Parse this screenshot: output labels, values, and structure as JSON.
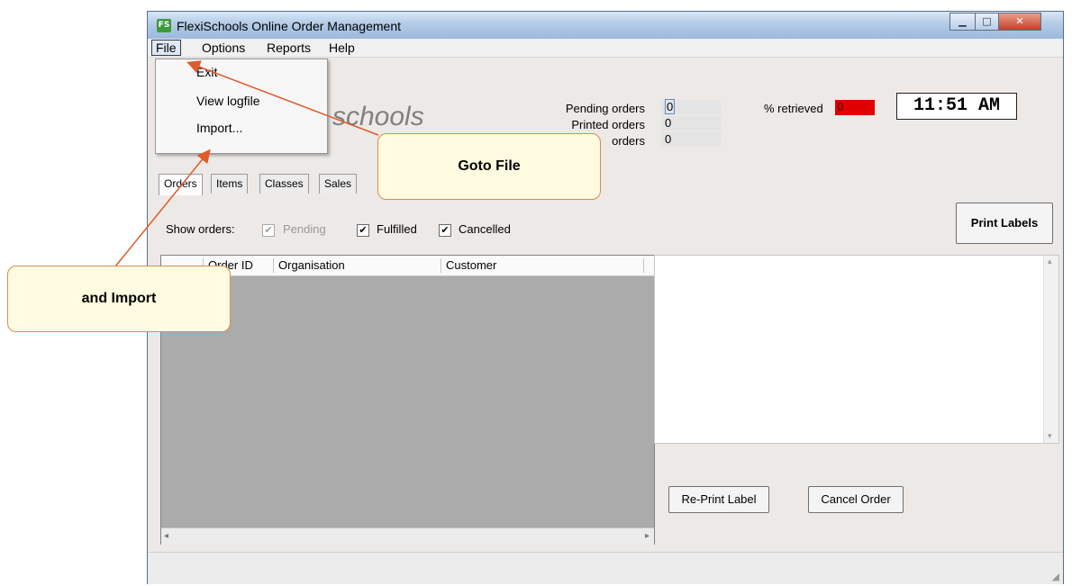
{
  "window": {
    "title": "FlexiSchools Online Order Management",
    "app_icon_text": "FS",
    "min_glyph": "▁",
    "max_glyph": "□",
    "close_glyph": "✕"
  },
  "menu": {
    "file": "File",
    "options": "Options",
    "reports": "Reports",
    "help": "Help"
  },
  "file_menu": {
    "items": [
      "Exit",
      "View logfile",
      "Import..."
    ]
  },
  "logo": "schools",
  "stats": {
    "pending_label": "Pending orders",
    "pending_value": "0",
    "printed_label": "Printed orders",
    "printed_value": "0",
    "other_label": "orders",
    "other_value": "0"
  },
  "retrieved": {
    "label": "% retrieved",
    "value": "0",
    "bar_color": "#e00000"
  },
  "clock": "11:51 AM",
  "tabs": [
    "Orders",
    "Items",
    "Classes",
    "Sales"
  ],
  "filters": {
    "label": "Show orders:",
    "pending": "Pending",
    "fulfilled": "Fulfilled",
    "cancelled": "Cancelled",
    "check_glyph": "✔"
  },
  "buttons": {
    "print_labels": "Print Labels",
    "reprint_label": "Re-Print Label",
    "cancel_order": "Cancel Order"
  },
  "grid": {
    "columns": [
      "Order ID",
      "Organisation",
      "Customer"
    ]
  },
  "callouts": {
    "goto_file": "Goto File",
    "and_import": "and Import"
  }
}
